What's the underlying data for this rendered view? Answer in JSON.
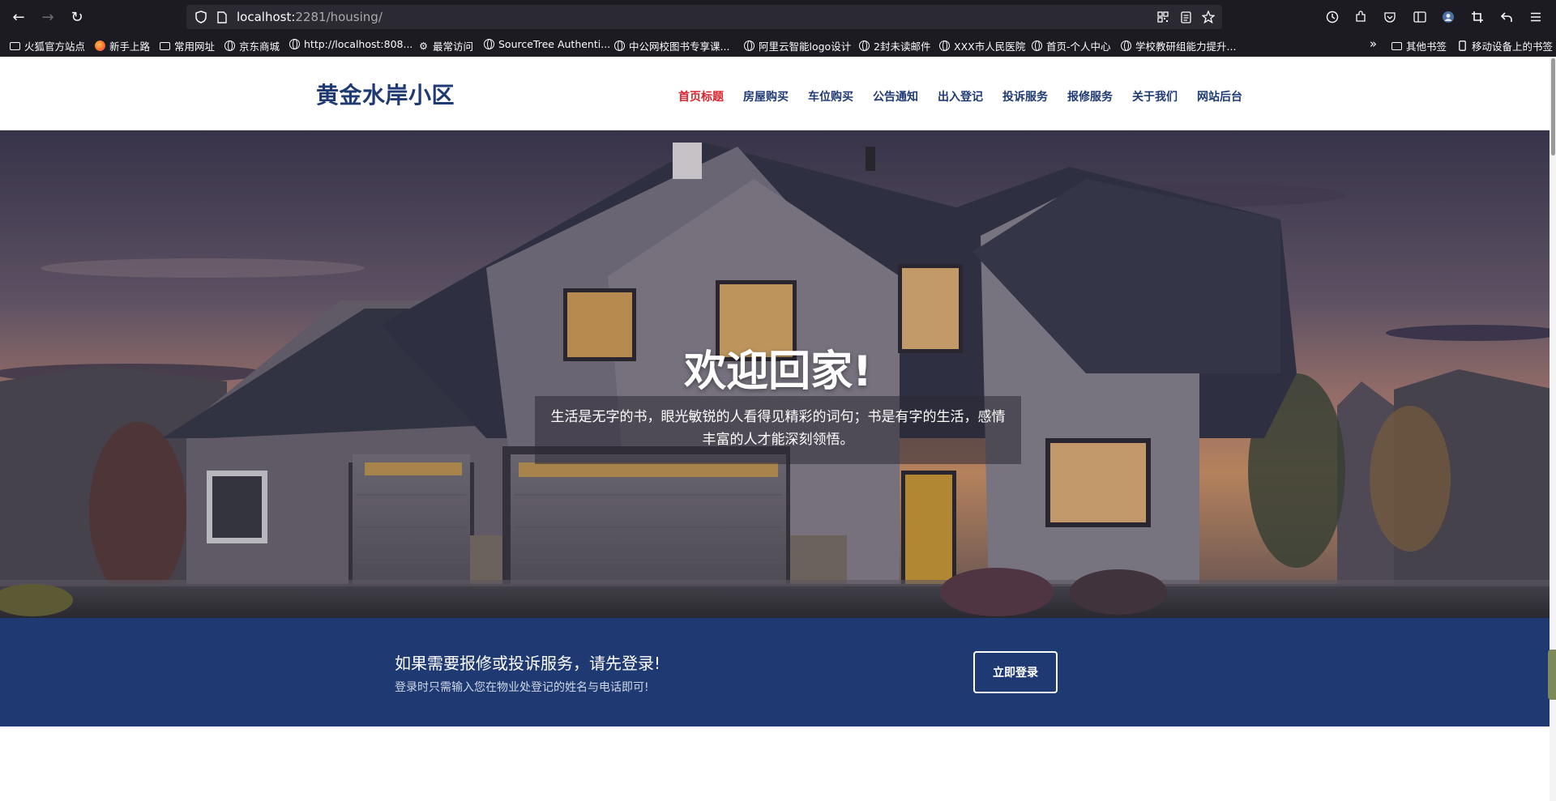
{
  "browser": {
    "url_host": "localhost:",
    "url_rest": "2281/housing/",
    "bookmarks": [
      {
        "label": "火狐官方站点",
        "icon": "folder-icon"
      },
      {
        "label": "新手上路",
        "icon": "firefox-icon"
      },
      {
        "label": "常用网址",
        "icon": "folder-icon"
      },
      {
        "label": "京东商城",
        "icon": "globe-icon"
      },
      {
        "label": "http://localhost:808...",
        "icon": "globe-icon"
      },
      {
        "label": "最常访问",
        "icon": "gear-icon"
      },
      {
        "label": "SourceTree Authenti...",
        "icon": "globe-icon"
      },
      {
        "label": "中公网校图书专享课...",
        "icon": "globe-icon"
      },
      {
        "label": "阿里云智能logo设计",
        "icon": "globe-icon"
      },
      {
        "label": "2封未读邮件",
        "icon": "globe-icon"
      },
      {
        "label": "XXX市人民医院",
        "icon": "globe-icon"
      },
      {
        "label": "首页-个人中心",
        "icon": "globe-icon"
      },
      {
        "label": "学校教研组能力提升...",
        "icon": "globe-icon"
      }
    ],
    "other_bookmarks": "其他书签",
    "mobile_bookmarks": "移动设备上的书签"
  },
  "header": {
    "logo": "黄金水岸小区",
    "menu": [
      {
        "label": "首页标题",
        "active": true
      },
      {
        "label": "房屋购买",
        "active": false
      },
      {
        "label": "车位购买",
        "active": false
      },
      {
        "label": "公告通知",
        "active": false
      },
      {
        "label": "出入登记",
        "active": false
      },
      {
        "label": "投诉服务",
        "active": false
      },
      {
        "label": "报修服务",
        "active": false
      },
      {
        "label": "关于我们",
        "active": false
      },
      {
        "label": "网站后台",
        "active": false
      }
    ]
  },
  "hero": {
    "title": "欢迎回家!",
    "text": "生活是无字的书，眼光敏锐的人看得见精彩的词句；书是有字的生活，感情丰富的人才能深刻领悟。"
  },
  "cta": {
    "title": "如果需要报修或投诉服务，请先登录!",
    "subtitle": "登录时只需输入您在物业处登记的姓名与电话即可!",
    "button": "立即登录"
  },
  "colors": {
    "brand": "#1f3a73",
    "active": "#d9232d",
    "chrome": "#1c1b22"
  }
}
